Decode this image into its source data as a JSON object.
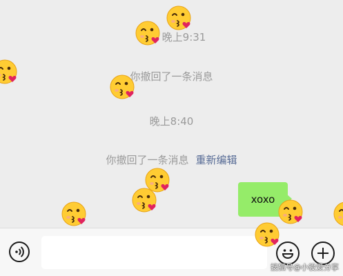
{
  "chat": {
    "timestamp_1": "晚上9:31",
    "recall_1": "你撤回了一条消息",
    "timestamp_2": "晚上8:40",
    "recall_2": "你撤回了一条消息",
    "reedit_link": "重新编辑",
    "message_text": "xoxo"
  },
  "input_bar": {
    "input_value": "",
    "voice_icon": "voice-icon",
    "emoji_icon": "emoji-smile-icon",
    "plus_icon": "plus-icon"
  },
  "overlay": {
    "emoji_icon": "kissing-heart-emoji",
    "watermark": "搜狐号@小役爱分享"
  },
  "colors": {
    "background": "#ededed",
    "bubble": "#95ec69",
    "link": "#576b95",
    "system_text": "#9a9a9a",
    "emoji_face": "#ffcc33",
    "heart": "#e0245e"
  }
}
